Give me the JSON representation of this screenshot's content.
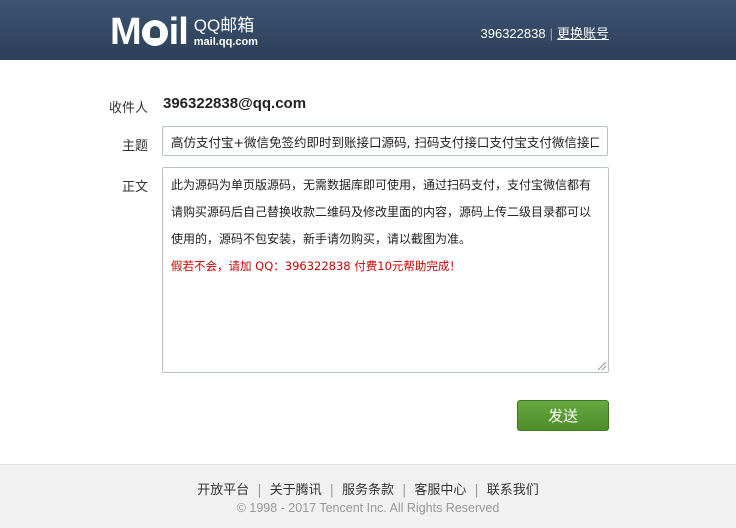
{
  "header": {
    "logo_mail": "M",
    "logo_mail_tail": "il",
    "logo_product": "QQ邮箱",
    "logo_domain": "mail.qq.com",
    "account_id": "396322838",
    "separator": "|",
    "switch_account": "更换账号"
  },
  "form": {
    "recipient_label": "收件人",
    "recipient_value": "396322838@qq.com",
    "subject_label": "主题",
    "subject_value": "高仿支付宝+微信免签约即时到账接口源码, 扫码支付接口支付宝支付微信接口",
    "body_label": "正文",
    "body_lines": [
      "此为源码为单页版源码，无需数据库即可使用，通过扫码支付，支付宝微信都有",
      "请购买源码后自己替换收款二维码及修改里面的内容，源码上传二级目录都可以",
      "使用的，源码不包安装，新手请勿购买，请以截图为准。"
    ],
    "body_note": "假若不会，请加 QQ：396322838 付费10元帮助完成！",
    "send_label": "发送"
  },
  "footer": {
    "links": [
      "开放平台",
      "关于腾讯",
      "服务条款",
      "客服中心",
      "联系我们"
    ],
    "separator": "|",
    "copyright": "© 1998 - 2017 Tencent Inc. All Rights Reserved"
  },
  "colors": {
    "header_bg": "#33475f",
    "send_button": "#58a035",
    "note_text": "#cc0000"
  }
}
